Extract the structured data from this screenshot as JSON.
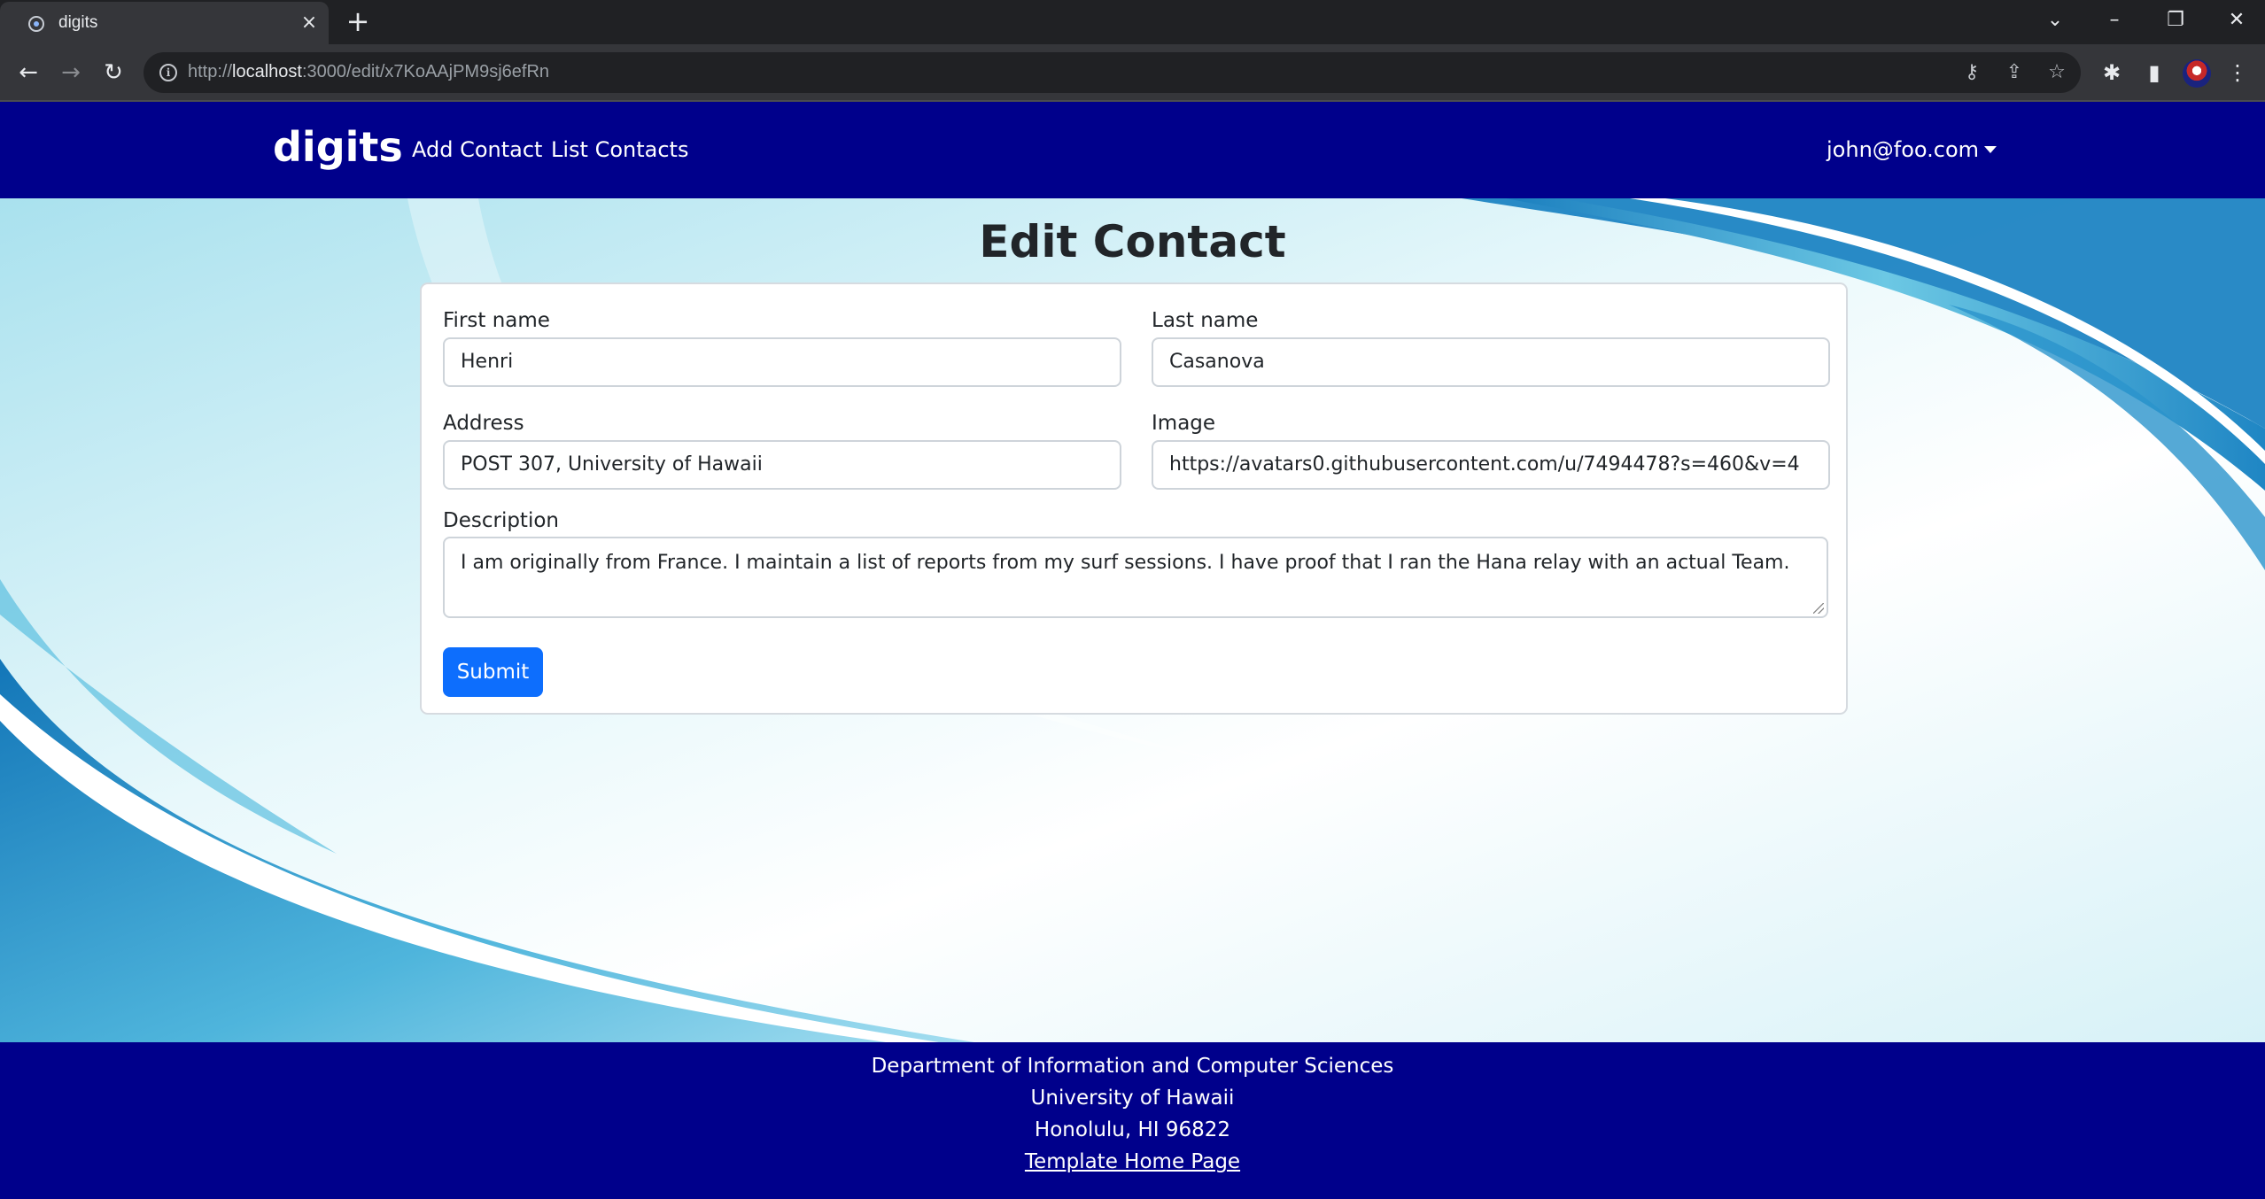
{
  "browser": {
    "tab_title": "digits",
    "url_scheme": "http://",
    "url_host": "localhost",
    "url_path": ":3000/edit/x7KoAAjPM9sj6efRn"
  },
  "icons": {
    "tab_close": "×",
    "new_tab": "+",
    "back": "←",
    "forward": "→",
    "reload": "↻",
    "info": "i",
    "key": "⚷",
    "share": "⇪",
    "star": "☆",
    "puzzle": "✱",
    "sidebar": "▮",
    "menu": "⋮",
    "tab_search": "⌄",
    "minimize": "–",
    "restore": "❐",
    "close": "✕"
  },
  "navbar": {
    "brand": "digits",
    "links": [
      {
        "label": "Add Contact"
      },
      {
        "label": "List Contacts"
      }
    ],
    "user": "john@foo.com"
  },
  "form": {
    "title": "Edit Contact",
    "first_name": {
      "label": "First name",
      "value": "Henri"
    },
    "last_name": {
      "label": "Last name",
      "value": "Casanova"
    },
    "address": {
      "label": "Address",
      "value": "POST 307, University of Hawaii"
    },
    "image": {
      "label": "Image",
      "value": "https://avatars0.githubusercontent.com/u/7494478?s=460&v=4"
    },
    "description": {
      "label": "Description",
      "value": "I am originally from France. I maintain a list of reports from my surf sessions. I have proof that I ran the Hana relay with an actual Team."
    },
    "submit_label": "Submit"
  },
  "footer": {
    "line1": "Department of Information and Computer Sciences",
    "line2": "University of Hawaii",
    "line3": "Honolulu, HI 96822",
    "link": "Template Home Page"
  },
  "colors": {
    "navbar_bg": "#00008b",
    "submit_bg": "#0d6efd",
    "wave_blue": "#2a8fc7"
  }
}
